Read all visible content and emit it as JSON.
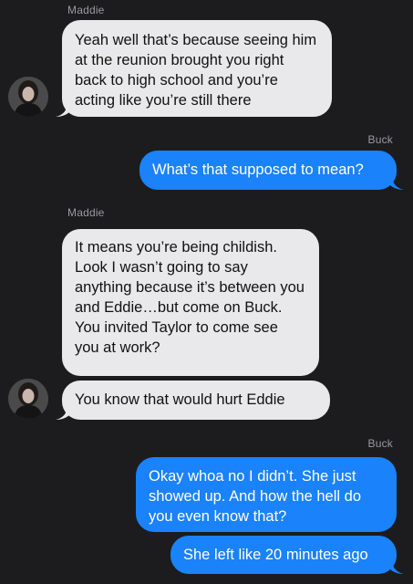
{
  "messages": [
    {
      "sender": "Maddie",
      "text": "Yeah well that’s because seeing him at the reunion brought you right back to high school and you’re acting like you’re still there"
    },
    {
      "sender": "Buck",
      "text": "What’s that supposed to mean?"
    },
    {
      "sender": "Maddie",
      "text": "It means you’re being childish. Look I wasn’t going to say anything because it’s between you and Eddie…but come on Buck.\nYou invited Taylor to come see you at work?"
    },
    {
      "text": "You know that would hurt Eddie"
    },
    {
      "sender": "Buck",
      "text": "Okay whoa no I didn’t. She just showed up. And how the hell do you even know that?"
    },
    {
      "text": "She left like 20 minutes ago"
    }
  ],
  "colors": {
    "background": "#1c1c1e",
    "incoming_bubble": "#e9e9eb",
    "outgoing_bubble": "#1a82fb",
    "sender_label": "#9a9a9f"
  },
  "icons": {
    "avatar": "contact-photo-avatar"
  }
}
